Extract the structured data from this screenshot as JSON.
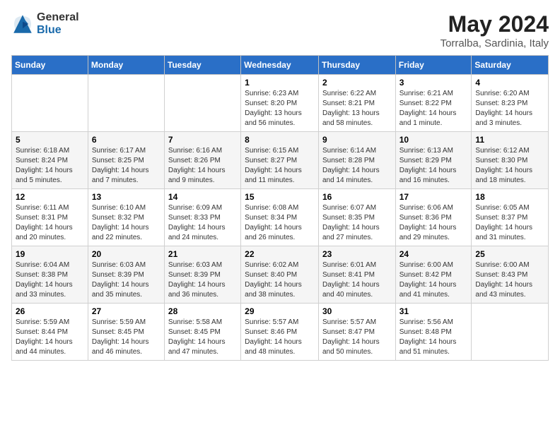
{
  "header": {
    "logo_general": "General",
    "logo_blue": "Blue",
    "month_title": "May 2024",
    "location": "Torralba, Sardinia, Italy"
  },
  "days_of_week": [
    "Sunday",
    "Monday",
    "Tuesday",
    "Wednesday",
    "Thursday",
    "Friday",
    "Saturday"
  ],
  "weeks": [
    [
      {
        "day": "",
        "sunrise": "",
        "sunset": "",
        "daylight": ""
      },
      {
        "day": "",
        "sunrise": "",
        "sunset": "",
        "daylight": ""
      },
      {
        "day": "",
        "sunrise": "",
        "sunset": "",
        "daylight": ""
      },
      {
        "day": "1",
        "sunrise": "Sunrise: 6:23 AM",
        "sunset": "Sunset: 8:20 PM",
        "daylight": "Daylight: 13 hours and 56 minutes."
      },
      {
        "day": "2",
        "sunrise": "Sunrise: 6:22 AM",
        "sunset": "Sunset: 8:21 PM",
        "daylight": "Daylight: 13 hours and 58 minutes."
      },
      {
        "day": "3",
        "sunrise": "Sunrise: 6:21 AM",
        "sunset": "Sunset: 8:22 PM",
        "daylight": "Daylight: 14 hours and 1 minute."
      },
      {
        "day": "4",
        "sunrise": "Sunrise: 6:20 AM",
        "sunset": "Sunset: 8:23 PM",
        "daylight": "Daylight: 14 hours and 3 minutes."
      }
    ],
    [
      {
        "day": "5",
        "sunrise": "Sunrise: 6:18 AM",
        "sunset": "Sunset: 8:24 PM",
        "daylight": "Daylight: 14 hours and 5 minutes."
      },
      {
        "day": "6",
        "sunrise": "Sunrise: 6:17 AM",
        "sunset": "Sunset: 8:25 PM",
        "daylight": "Daylight: 14 hours and 7 minutes."
      },
      {
        "day": "7",
        "sunrise": "Sunrise: 6:16 AM",
        "sunset": "Sunset: 8:26 PM",
        "daylight": "Daylight: 14 hours and 9 minutes."
      },
      {
        "day": "8",
        "sunrise": "Sunrise: 6:15 AM",
        "sunset": "Sunset: 8:27 PM",
        "daylight": "Daylight: 14 hours and 11 minutes."
      },
      {
        "day": "9",
        "sunrise": "Sunrise: 6:14 AM",
        "sunset": "Sunset: 8:28 PM",
        "daylight": "Daylight: 14 hours and 14 minutes."
      },
      {
        "day": "10",
        "sunrise": "Sunrise: 6:13 AM",
        "sunset": "Sunset: 8:29 PM",
        "daylight": "Daylight: 14 hours and 16 minutes."
      },
      {
        "day": "11",
        "sunrise": "Sunrise: 6:12 AM",
        "sunset": "Sunset: 8:30 PM",
        "daylight": "Daylight: 14 hours and 18 minutes."
      }
    ],
    [
      {
        "day": "12",
        "sunrise": "Sunrise: 6:11 AM",
        "sunset": "Sunset: 8:31 PM",
        "daylight": "Daylight: 14 hours and 20 minutes."
      },
      {
        "day": "13",
        "sunrise": "Sunrise: 6:10 AM",
        "sunset": "Sunset: 8:32 PM",
        "daylight": "Daylight: 14 hours and 22 minutes."
      },
      {
        "day": "14",
        "sunrise": "Sunrise: 6:09 AM",
        "sunset": "Sunset: 8:33 PM",
        "daylight": "Daylight: 14 hours and 24 minutes."
      },
      {
        "day": "15",
        "sunrise": "Sunrise: 6:08 AM",
        "sunset": "Sunset: 8:34 PM",
        "daylight": "Daylight: 14 hours and 26 minutes."
      },
      {
        "day": "16",
        "sunrise": "Sunrise: 6:07 AM",
        "sunset": "Sunset: 8:35 PM",
        "daylight": "Daylight: 14 hours and 27 minutes."
      },
      {
        "day": "17",
        "sunrise": "Sunrise: 6:06 AM",
        "sunset": "Sunset: 8:36 PM",
        "daylight": "Daylight: 14 hours and 29 minutes."
      },
      {
        "day": "18",
        "sunrise": "Sunrise: 6:05 AM",
        "sunset": "Sunset: 8:37 PM",
        "daylight": "Daylight: 14 hours and 31 minutes."
      }
    ],
    [
      {
        "day": "19",
        "sunrise": "Sunrise: 6:04 AM",
        "sunset": "Sunset: 8:38 PM",
        "daylight": "Daylight: 14 hours and 33 minutes."
      },
      {
        "day": "20",
        "sunrise": "Sunrise: 6:03 AM",
        "sunset": "Sunset: 8:39 PM",
        "daylight": "Daylight: 14 hours and 35 minutes."
      },
      {
        "day": "21",
        "sunrise": "Sunrise: 6:03 AM",
        "sunset": "Sunset: 8:39 PM",
        "daylight": "Daylight: 14 hours and 36 minutes."
      },
      {
        "day": "22",
        "sunrise": "Sunrise: 6:02 AM",
        "sunset": "Sunset: 8:40 PM",
        "daylight": "Daylight: 14 hours and 38 minutes."
      },
      {
        "day": "23",
        "sunrise": "Sunrise: 6:01 AM",
        "sunset": "Sunset: 8:41 PM",
        "daylight": "Daylight: 14 hours and 40 minutes."
      },
      {
        "day": "24",
        "sunrise": "Sunrise: 6:00 AM",
        "sunset": "Sunset: 8:42 PM",
        "daylight": "Daylight: 14 hours and 41 minutes."
      },
      {
        "day": "25",
        "sunrise": "Sunrise: 6:00 AM",
        "sunset": "Sunset: 8:43 PM",
        "daylight": "Daylight: 14 hours and 43 minutes."
      }
    ],
    [
      {
        "day": "26",
        "sunrise": "Sunrise: 5:59 AM",
        "sunset": "Sunset: 8:44 PM",
        "daylight": "Daylight: 14 hours and 44 minutes."
      },
      {
        "day": "27",
        "sunrise": "Sunrise: 5:59 AM",
        "sunset": "Sunset: 8:45 PM",
        "daylight": "Daylight: 14 hours and 46 minutes."
      },
      {
        "day": "28",
        "sunrise": "Sunrise: 5:58 AM",
        "sunset": "Sunset: 8:45 PM",
        "daylight": "Daylight: 14 hours and 47 minutes."
      },
      {
        "day": "29",
        "sunrise": "Sunrise: 5:57 AM",
        "sunset": "Sunset: 8:46 PM",
        "daylight": "Daylight: 14 hours and 48 minutes."
      },
      {
        "day": "30",
        "sunrise": "Sunrise: 5:57 AM",
        "sunset": "Sunset: 8:47 PM",
        "daylight": "Daylight: 14 hours and 50 minutes."
      },
      {
        "day": "31",
        "sunrise": "Sunrise: 5:56 AM",
        "sunset": "Sunset: 8:48 PM",
        "daylight": "Daylight: 14 hours and 51 minutes."
      },
      {
        "day": "",
        "sunrise": "",
        "sunset": "",
        "daylight": ""
      }
    ]
  ]
}
